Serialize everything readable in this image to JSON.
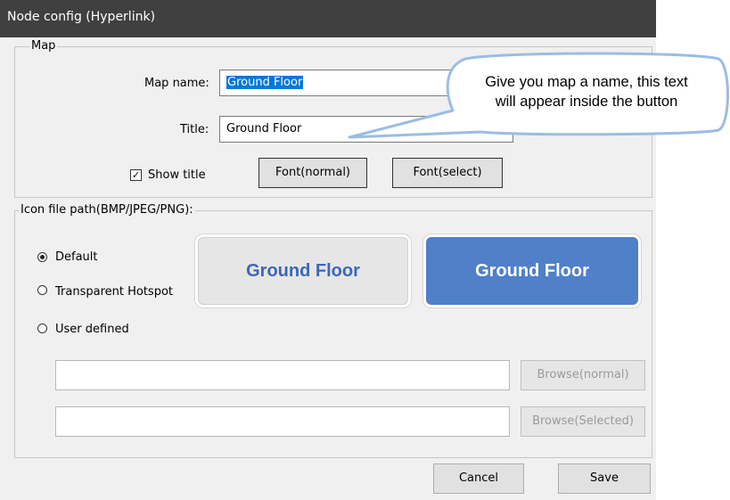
{
  "window": {
    "title": "Node config (Hyperlink)"
  },
  "map_group": {
    "legend": "Map",
    "map_name_label": "Map name:",
    "map_name_value": "Ground Floor",
    "title_label": "Title:",
    "title_value": "Ground Floor",
    "show_title_label": "Show title",
    "show_title_checked": true,
    "font_normal_button": "Font(normal)",
    "font_select_button": "Font(select)"
  },
  "icon_group": {
    "legend": "Icon file path(BMP/JPEG/PNG):",
    "options": [
      {
        "label": "Default",
        "checked": true
      },
      {
        "label": "Transparent Hotspot",
        "checked": false
      },
      {
        "label": "User defined",
        "checked": false
      }
    ],
    "preview_normal_text": "Ground Floor",
    "preview_selected_text": "Ground Floor",
    "path_normal_value": "",
    "path_selected_value": "",
    "browse_normal_button": "Browse(normal)",
    "browse_selected_button": "Browse(Selected)"
  },
  "footer": {
    "cancel_button": "Cancel",
    "save_button": "Save"
  },
  "callout": {
    "line1": "Give you map a name, this text",
    "line2": "will appear inside the button"
  },
  "colors": {
    "titlebar": "#404040",
    "selected_preview": "#4f80c8",
    "normal_preview_text": "#3a68b8",
    "callout_border": "#9bbde3"
  }
}
